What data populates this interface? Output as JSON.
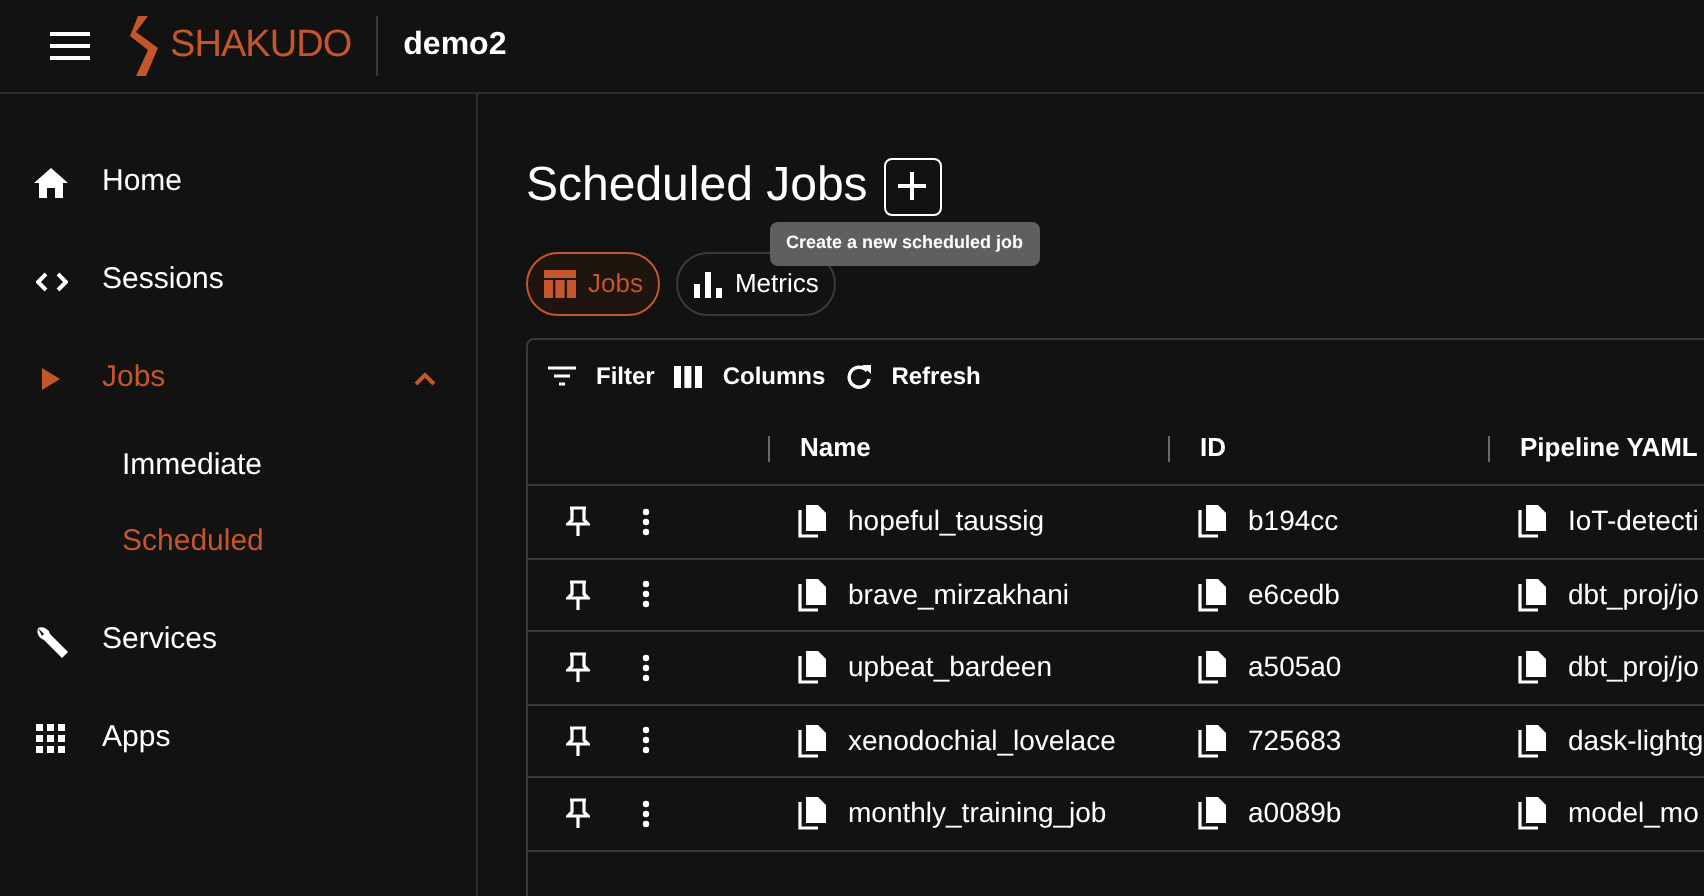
{
  "header": {
    "brand": "SHAKUDO",
    "workspace": "demo2"
  },
  "sidebar": {
    "items": [
      {
        "kind": "home",
        "label": "Home",
        "selected": false
      },
      {
        "kind": "code",
        "label": "Sessions",
        "selected": false
      },
      {
        "kind": "play",
        "label": "Jobs",
        "selected": true,
        "expanded": true,
        "children": [
          {
            "label": "Immediate",
            "selected": false
          },
          {
            "label": "Scheduled",
            "selected": true
          }
        ]
      },
      {
        "kind": "wrench",
        "label": "Services",
        "selected": false
      },
      {
        "kind": "grid",
        "label": "Apps",
        "selected": false
      }
    ]
  },
  "page": {
    "title": "Scheduled Jobs",
    "tooltip": "Create a new scheduled job"
  },
  "tabs": [
    {
      "kind": "table",
      "label": "Jobs",
      "selected": true
    },
    {
      "kind": "bars",
      "label": "Metrics",
      "selected": false
    }
  ],
  "toolbar": [
    {
      "kind": "filter",
      "label": "Filter"
    },
    {
      "kind": "columns",
      "label": "Columns"
    },
    {
      "kind": "refresh",
      "label": "Refresh"
    }
  ],
  "table": {
    "columns": [
      "Name",
      "ID",
      "Pipeline YAML"
    ],
    "rows": [
      [
        "hopeful_taussig",
        "b194cc",
        "IoT-detecti"
      ],
      [
        "brave_mirzakhani",
        "e6cedb",
        "dbt_proj/jo"
      ],
      [
        "upbeat_bardeen",
        "a505a0",
        "dbt_proj/jo"
      ],
      [
        "xenodochial_lovelace",
        "725683",
        "dask-lightg"
      ],
      [
        "monthly_training_job",
        "a0089b",
        "model_mo"
      ]
    ]
  }
}
